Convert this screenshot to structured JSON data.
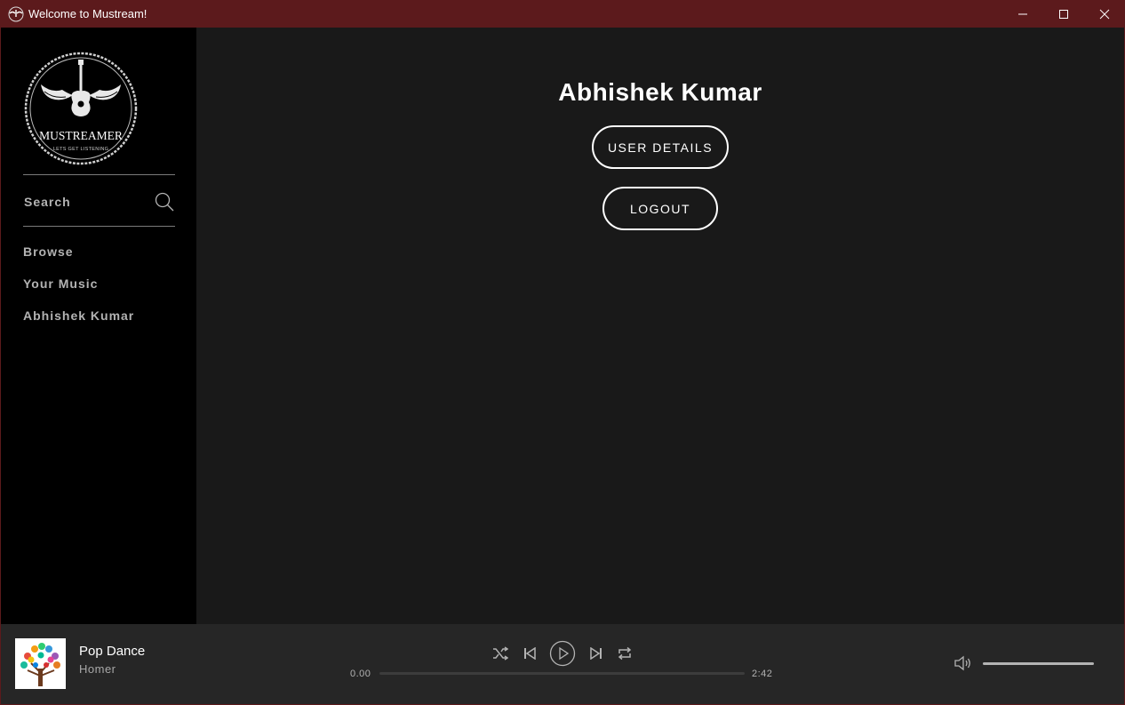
{
  "window": {
    "title": "Welcome to Mustream!",
    "minimize_glyph": "—",
    "maximize_glyph": "☐",
    "close_glyph": "✕"
  },
  "sidebar": {
    "logo": {
      "brand": "MUSTREAMER",
      "tagline": "LETS GET LISTENING"
    },
    "search": {
      "placeholder": "Search",
      "value": ""
    },
    "nav": [
      {
        "label": "Browse"
      },
      {
        "label": "Your Music"
      },
      {
        "label": "Abhishek Kumar"
      }
    ]
  },
  "main": {
    "user_name": "Abhishek Kumar",
    "buttons": {
      "user_details": "USER DETAILS",
      "logout": "LOGOUT"
    }
  },
  "player": {
    "track": {
      "title": "Pop Dance",
      "artist": "Homer"
    },
    "current_time": "0.00",
    "duration": "2:42",
    "progress": 0,
    "volume": 1.0
  },
  "colors": {
    "titlebar": "#5c1a1c",
    "sidebar": "#000000",
    "main_bg": "#191919",
    "player_bg": "#262626",
    "accent_text": "#ffffff",
    "muted_text": "#b3b3b3"
  },
  "icons": {
    "app": "mustreamer-logo-icon",
    "search": "search-icon",
    "shuffle": "shuffle-icon",
    "previous": "previous-icon",
    "play": "play-icon",
    "next": "next-icon",
    "repeat": "repeat-icon",
    "volume": "volume-icon"
  }
}
